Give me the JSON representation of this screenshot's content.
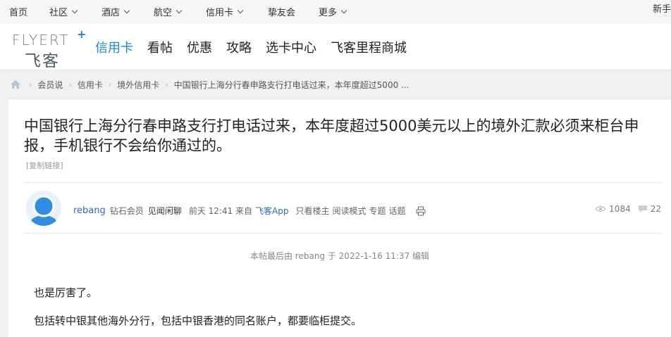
{
  "topnav": {
    "items": [
      {
        "label": "首页",
        "dropdown": false
      },
      {
        "label": "社区",
        "dropdown": true
      },
      {
        "label": "酒店",
        "dropdown": true
      },
      {
        "label": "航空",
        "dropdown": true
      },
      {
        "label": "信用卡",
        "dropdown": true
      },
      {
        "label": "挚友会",
        "dropdown": false
      },
      {
        "label": "更多",
        "dropdown": true
      }
    ],
    "right_label": "新手"
  },
  "header": {
    "logo_en": "FLYERT",
    "logo_plus": "+",
    "logo_cn": "飞客",
    "nav": [
      "信用卡",
      "看帖",
      "优惠",
      "攻略",
      "选卡中心",
      "飞客里程商城"
    ],
    "active_nav": "信用卡"
  },
  "breadcrumb": {
    "items": [
      "会员说",
      "信用卡",
      "境外信用卡",
      "中国银行上海分行春申路支行打电话过来，本年度超过5000 ..."
    ],
    "separator": "›"
  },
  "post": {
    "title": "中国银行上海分行春申路支行打电话过来，本年度超过5000美元以上的境外汇款必须来柜台申报，手机银行不会给你通过的。",
    "copy_link": "[复制链接]",
    "author": "rebang",
    "level": "钻石会员",
    "signature": "见闻闲聊",
    "time": "前天 12:41 来自",
    "source": "飞客App",
    "actions": [
      "只看楼主",
      "阅读模式",
      "专题",
      "话题"
    ],
    "views": "1084",
    "replies": "22",
    "edit_note": "本帖最后由 rebang 于 2022-1-16 11:37 编辑",
    "body": [
      "也是厉害了。",
      "包括转中银其他海外分行，包括中银香港的同名账户，都要临柜提交。"
    ]
  },
  "colors": {
    "accent": "#1e88d8",
    "link": "#2b6cc4",
    "bg": "#f0f1f2"
  }
}
